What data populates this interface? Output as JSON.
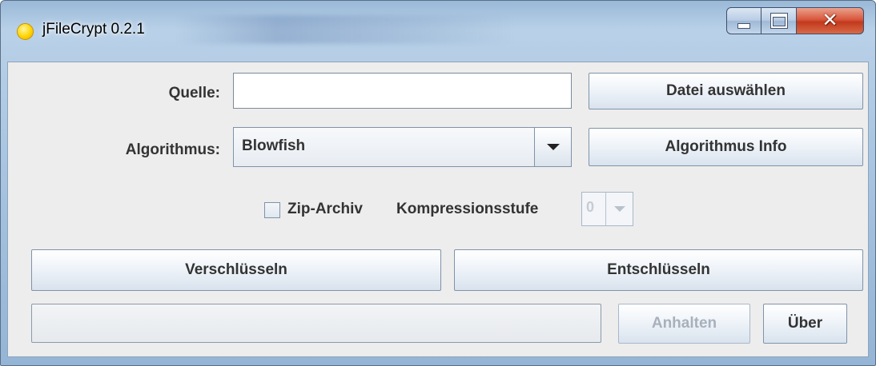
{
  "window": {
    "title": "jFileCrypt 0.2.1"
  },
  "source": {
    "label": "Quelle:",
    "value": "",
    "choose_button": "Datei auswählen"
  },
  "algorithm": {
    "label": "Algorithmus:",
    "selected": "Blowfish",
    "info_button": "Algorithmus Info"
  },
  "zip": {
    "checkbox_label": "Zip-Archiv",
    "checked": false,
    "compression_label": "Kompressionsstufe",
    "compression_value": "0"
  },
  "actions": {
    "encrypt_button": "Verschlüsseln",
    "decrypt_button": "Entschlüsseln"
  },
  "footer": {
    "progress": 0,
    "stop_button": "Anhalten",
    "about_button": "Über"
  }
}
